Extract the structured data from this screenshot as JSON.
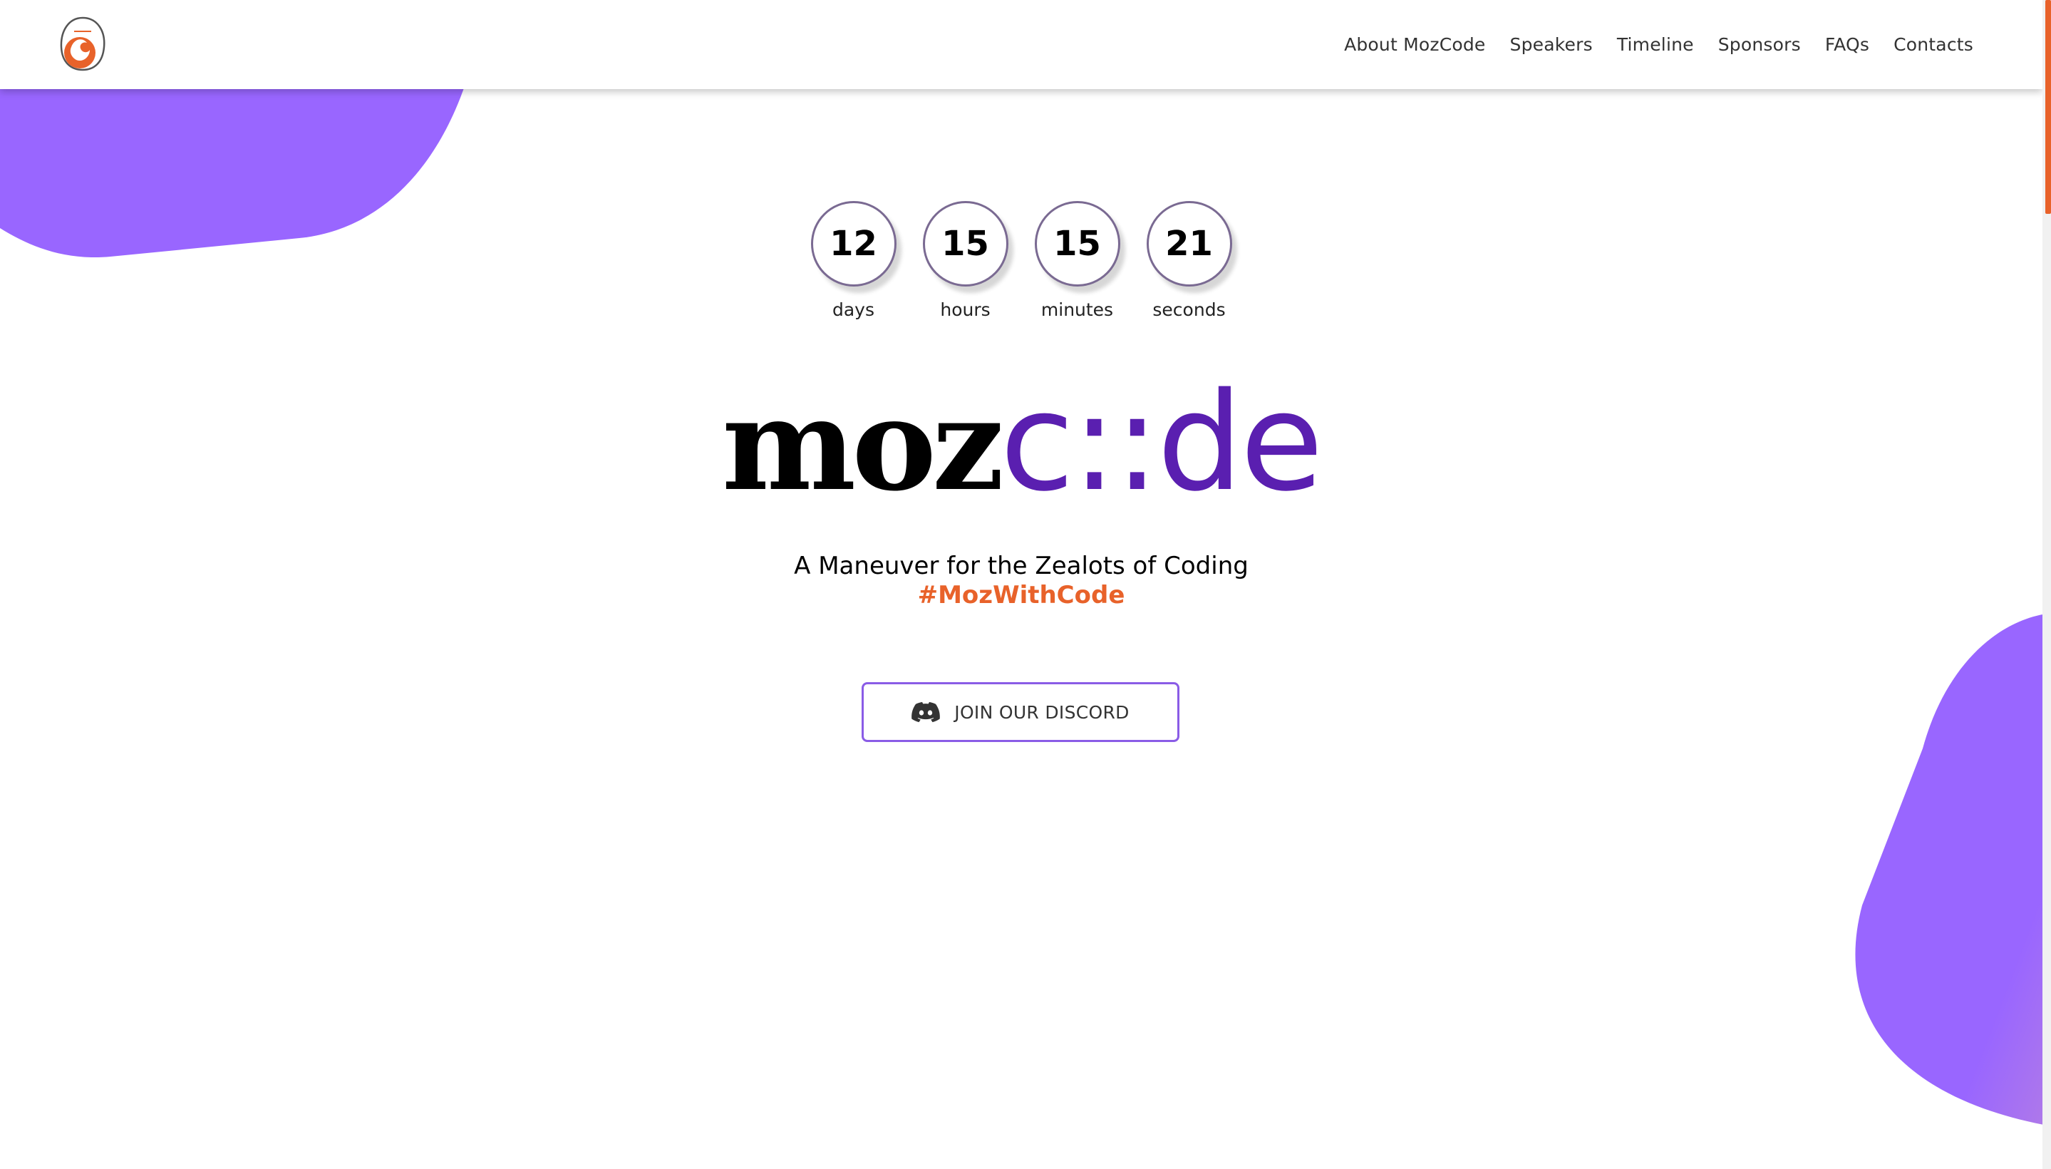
{
  "header": {
    "logo_icon": "mozcode-firefox-logo",
    "nav": [
      {
        "label": "About MozCode"
      },
      {
        "label": "Speakers"
      },
      {
        "label": "Timeline"
      },
      {
        "label": "Sponsors"
      },
      {
        "label": "FAQs"
      },
      {
        "label": "Contacts"
      }
    ]
  },
  "countdown": [
    {
      "value": "12",
      "label": "days"
    },
    {
      "value": "15",
      "label": "hours"
    },
    {
      "value": "15",
      "label": "minutes"
    },
    {
      "value": "21",
      "label": "seconds"
    }
  ],
  "hero": {
    "brand_part1": "moz",
    "brand_part2": "c::de",
    "tagline": "A Maneuver for the Zealots of Coding",
    "hashtag": "#MozWithCode",
    "cta_label": "JOIN OUR DISCORD",
    "cta_icon": "discord-icon"
  },
  "colors": {
    "accent_purple": "#5a1fb0",
    "blob_purple": "#9966ff",
    "accent_orange": "#e8622a"
  }
}
